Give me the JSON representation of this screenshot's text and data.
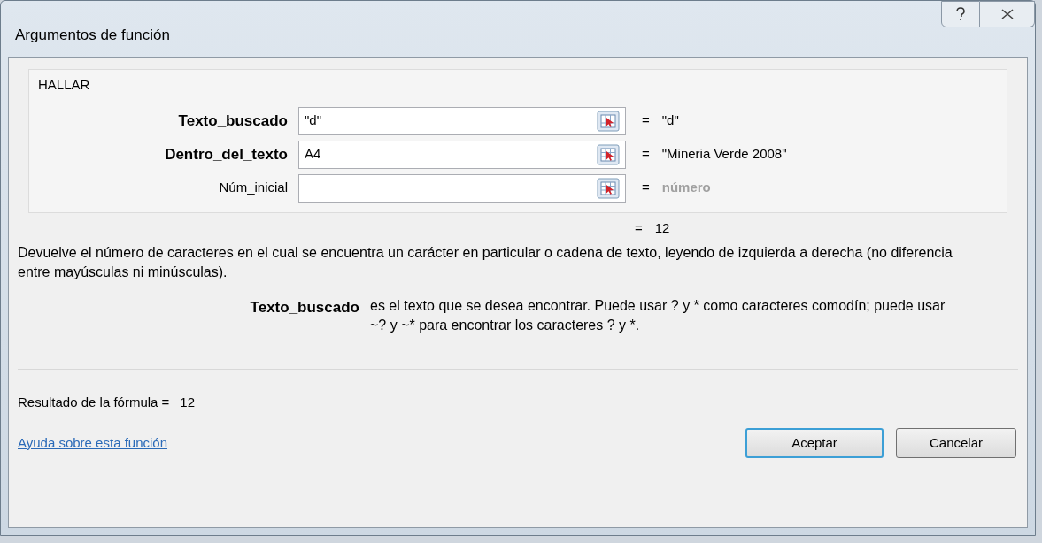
{
  "window": {
    "title": "Argumentos de función"
  },
  "function_name": "HALLAR",
  "arguments": [
    {
      "label": "Texto_buscado",
      "required": true,
      "value": "\"d\"",
      "equals": "=",
      "result": "\"d\"",
      "result_is_hint": false
    },
    {
      "label": "Dentro_del_texto",
      "required": true,
      "value": "A4",
      "equals": "=",
      "result": "\"Mineria Verde 2008\"",
      "result_is_hint": false
    },
    {
      "label": "Núm_inicial",
      "required": false,
      "equals": "=",
      "result": "número",
      "result_is_hint": true
    }
  ],
  "function_result_equals": "=",
  "function_result": "12",
  "description": "Devuelve el número de caracteres en el cual se encuentra un carácter en particular o cadena de texto, leyendo de izquierda a derecha (no diferencia entre mayúsculas ni minúsculas).",
  "argument_help": {
    "label": "Texto_buscado",
    "text": "es el texto que se desea encontrar. Puede usar ? y * como caracteres comodín; puede usar ~? y ~* para encontrar los caracteres ? y *."
  },
  "formula_result": {
    "label": "Resultado de la fórmula =",
    "value": "12"
  },
  "help_link": "Ayuda sobre esta función",
  "buttons": [
    {
      "label": "Aceptar",
      "default": true
    },
    {
      "label": "Cancelar",
      "default": false
    }
  ]
}
